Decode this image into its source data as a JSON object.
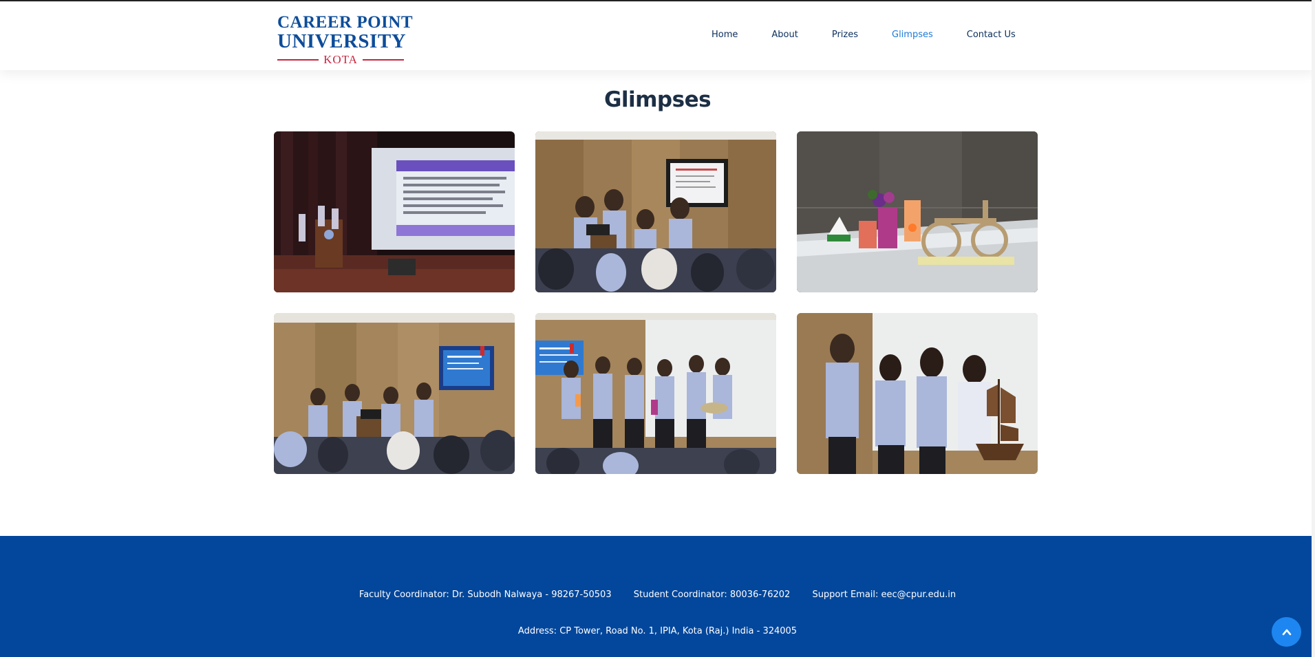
{
  "brand": {
    "line1": "CAREER POINT",
    "line2": "UNIVERSITY",
    "line3": "KOTA",
    "primary_color": "#0d4d9a",
    "accent_color": "#c9233f"
  },
  "nav": {
    "items": [
      {
        "label": "Home"
      },
      {
        "label": "About"
      },
      {
        "label": "Prizes"
      },
      {
        "label": "Glimpses"
      },
      {
        "label": "Contact Us"
      }
    ],
    "active": "Glimpses",
    "active_color": "#1e7ad6"
  },
  "section": {
    "title": "Glimpses"
  },
  "gallery": {
    "photos": [
      {
        "subject": "auditorium-stage-presentation"
      },
      {
        "subject": "team-presenting-at-podium"
      },
      {
        "subject": "handicraft-display-table"
      },
      {
        "subject": "group-presentation-with-screen"
      },
      {
        "subject": "group-holding-craft-items"
      },
      {
        "subject": "students-with-ship-model"
      }
    ]
  },
  "footer": {
    "faculty_coordinator": "Faculty Coordinator: Dr. Subodh Nalwaya - 98267-50503",
    "student_coordinator": "Student Coordinator: 80036-76202",
    "support_email": "Support Email: eec@cpur.edu.in",
    "address": "Address: CP Tower, Road No. 1, IPIA, Kota (Raj.) India - 324005",
    "background_color": "#02479c"
  },
  "scroll_top": {
    "icon": "chevron-up-icon"
  }
}
